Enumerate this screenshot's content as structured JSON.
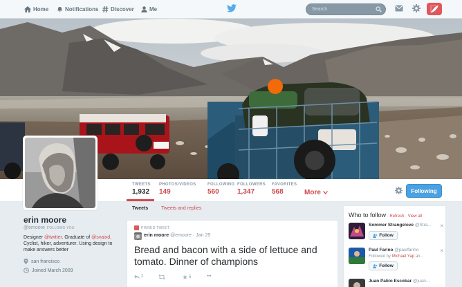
{
  "nav": {
    "home": "Home",
    "notifications": "Notifications",
    "discover": "Discover",
    "me": "Me",
    "search_placeholder": "Search"
  },
  "profile": {
    "name": "erin moore",
    "handle": "@emoore",
    "follows_you": "FOLLOWS YOU",
    "bio_1": "Designer ",
    "bio_m1": "@twitter",
    "bio_2": ". Graduate of ",
    "bio_m2": "@svaixd",
    "bio_3": ". Cyclist, hiker, adventurer. Using design to make answers better",
    "location": "san francisco",
    "joined": "Joined March 2009"
  },
  "stats": [
    {
      "label": "TWEETS",
      "value": "1,932"
    },
    {
      "label": "PHOTOS/VIDEOS",
      "value": "149"
    },
    {
      "label": "FOLLOWING",
      "value": "560"
    },
    {
      "label": "FOLLOWERS",
      "value": "1,347"
    },
    {
      "label": "FAVORITES",
      "value": "568"
    }
  ],
  "more_label": "More",
  "following_button": "Following",
  "tabs": {
    "tweets": "Tweets",
    "replies": "Tweets and replies"
  },
  "tweet": {
    "pinned_label": "PINNED TWEET",
    "author": "erin moore",
    "handle": "@emoore",
    "date": "Jan 29",
    "text": "Bread and bacon with a side of lettuce and tomato. Dinner of champions",
    "reply_count": "2",
    "fav_count": "5",
    "more": "•••"
  },
  "who_to_follow": {
    "title": "Who to follow",
    "refresh": "Refresh",
    "view_all": "View all",
    "sep": " · ",
    "follow_label": "Follow",
    "users": [
      {
        "name": "Sommer Strangelove",
        "handle": "@Stra..."
      },
      {
        "name": "Paul Farino",
        "handle": "@paulfarino",
        "followed_by_prefix": "Followed by ",
        "followed_by": "Michael Yap",
        "followed_by_suffix": " an..."
      },
      {
        "name": "Juan Pablo Escobar",
        "handle": "@juan..."
      }
    ]
  },
  "colors": {
    "accent": "#ce4a4f",
    "follow_blue": "#4ca1e0",
    "twitter_blue": "#55acee"
  }
}
